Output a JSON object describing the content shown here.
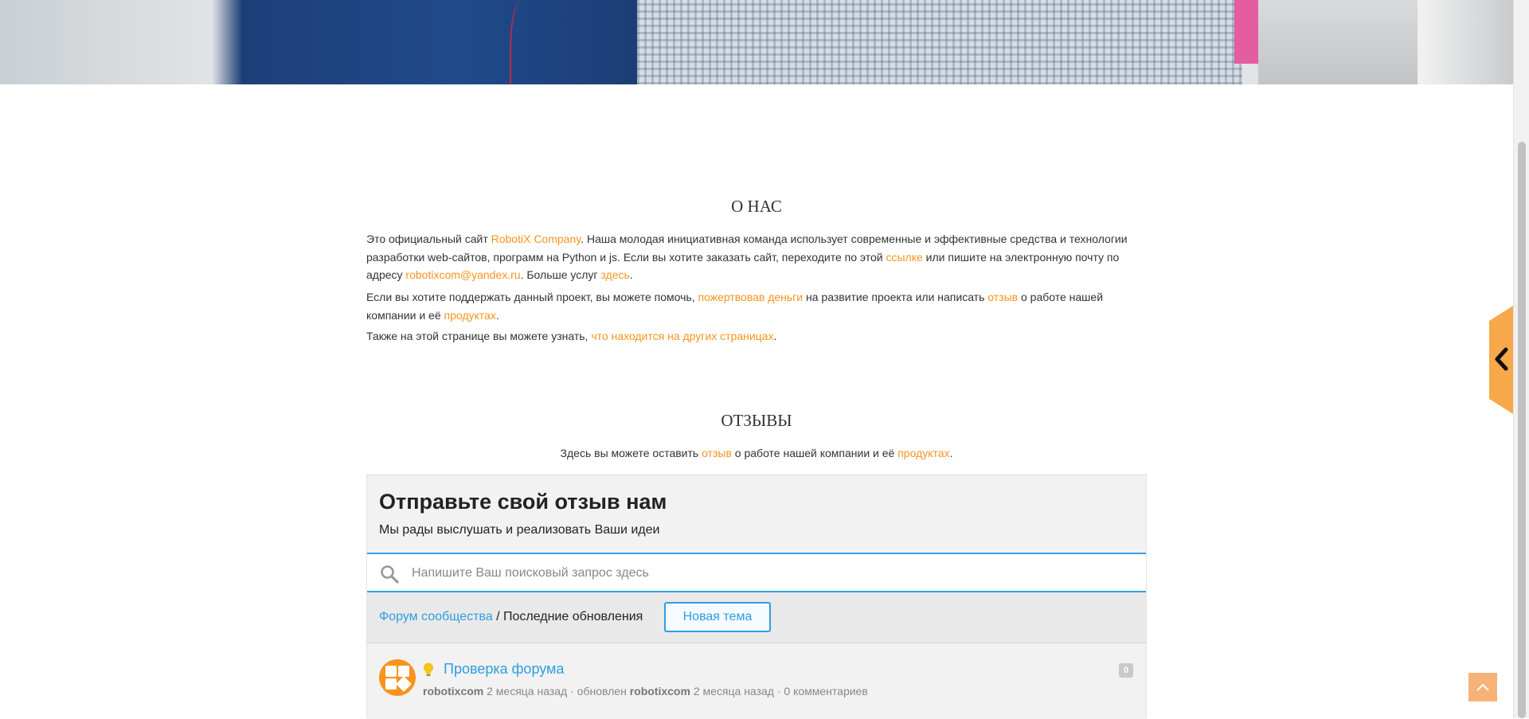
{
  "about": {
    "title": "О НАС",
    "p1_a": "Это официальный сайт ",
    "p1_link1": "RobotiX Company",
    "p1_b": ". Наша молодая инициативная команда использует современные и эффективные средства и технологии разработки web-сайтов, программ на Python и js. Если вы хотите заказать сайт, переходите по этой ",
    "p1_link2": "ссылке",
    "p1_c": " или пишите на электронную почту по адресу ",
    "p1_link3": "robotixcom@yandex.ru",
    "p1_d": ". Больше услуг ",
    "p1_link4": "здесь",
    "p1_e": ".",
    "p2_a": "Если вы хотите поддержать данный проект, вы можете помочь, ",
    "p2_link1": "пожертвовав деньги",
    "p2_b": " на развитие проекта или написать ",
    "p2_link2": "отзыв",
    "p2_c": " о работе нашей компании и её ",
    "p2_link3": "продуктах",
    "p2_d": ".",
    "p3_a": "Также на этой странице вы можете узнать, ",
    "p3_link1": "что находится на других страницах",
    "p3_b": "."
  },
  "reviews": {
    "title": "ОТЗЫВЫ",
    "p_a": "Здесь вы можете оставить ",
    "p_link1": "отзыв",
    "p_b": " о работе нашей компании и её ",
    "p_link2": "продуктах",
    "p_c": "."
  },
  "widget": {
    "heading": "Отправьте свой отзыв нам",
    "subheading": "Мы рады выслушать и реализовать Ваши идеи",
    "search_placeholder": "Напишите Ваш поисковый запрос здесь",
    "breadcrumb_link": "Форум сообщества",
    "breadcrumb_sep": " / ",
    "breadcrumb_current": "Последние обновления",
    "new_topic_label": "Новая тема",
    "topic": {
      "title": "Проверка форума",
      "author": "robotixcom",
      "created": "2 месяца назад",
      "sep1": " · обновлен ",
      "updater": "robotixcom",
      "updated": "2 месяца назад",
      "sep2": " · ",
      "comments": "0 комментариев",
      "count": "0"
    }
  },
  "colors": {
    "link": "#f7941d",
    "accent_blue": "#2f9ee2",
    "sidetab": "#f7a84a"
  },
  "icons": [
    "search-icon",
    "bulb-icon",
    "chevron-left-icon",
    "arrow-up-icon"
  ]
}
